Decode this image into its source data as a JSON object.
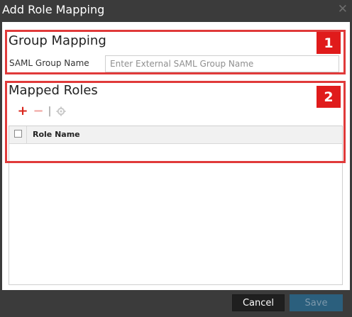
{
  "window": {
    "title": "Add Role Mapping",
    "close_symbol": "✕"
  },
  "group_mapping": {
    "title": "Group Mapping",
    "saml_label": "SAML Group Name",
    "saml_placeholder": "Enter External SAML Group Name",
    "saml_value": ""
  },
  "mapped_roles": {
    "title": "Mapped Roles",
    "toolbar": {
      "add_symbol": "+",
      "remove_symbol": "−",
      "separator": "|"
    },
    "table": {
      "columns": [
        "Role Name"
      ],
      "rows": []
    }
  },
  "callouts": {
    "badge_1": "1",
    "badge_2": "2",
    "color": "#e03a3a"
  },
  "footer": {
    "cancel_label": "Cancel",
    "save_label": "Save",
    "save_enabled": false
  },
  "icons": [
    "close-icon",
    "add-icon",
    "remove-icon",
    "settings-icon",
    "checkbox-icon"
  ],
  "colors": {
    "chrome": "#3b3b3b",
    "accent": "#2b5f7d",
    "add": "#d9261c"
  }
}
